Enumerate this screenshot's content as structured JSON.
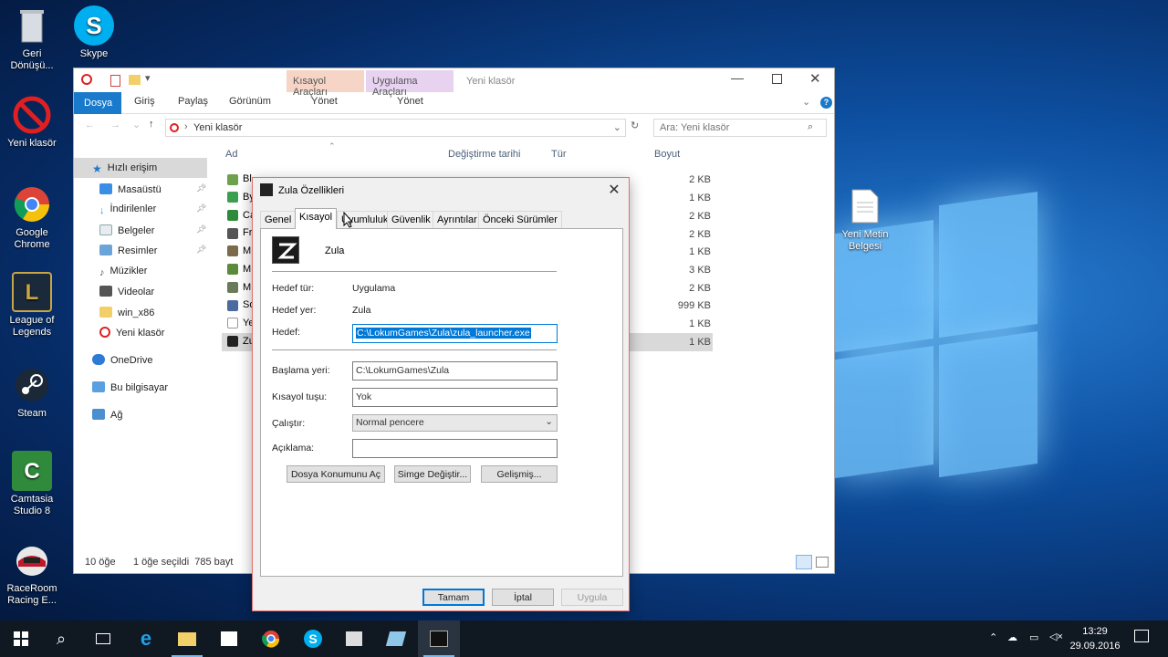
{
  "desktop": {
    "icons": [
      {
        "label": "Geri Dönüşü...",
        "icon": "recycle-bin-icon"
      },
      {
        "label": "Skype",
        "icon": "skype-icon"
      },
      {
        "label": "Yeni klasör",
        "icon": "no-entry-icon"
      },
      {
        "label": "Google Chrome",
        "icon": "chrome-icon"
      },
      {
        "label": "League of Legends",
        "icon": "league-icon"
      },
      {
        "label": "Steam",
        "icon": "steam-icon"
      },
      {
        "label": "Camtasia Studio 8",
        "icon": "camtasia-icon"
      },
      {
        "label": "RaceRoom Racing E...",
        "icon": "raceroom-icon"
      },
      {
        "label": "Yeni Metin Belgesi",
        "icon": "text-document-icon"
      }
    ]
  },
  "explorer": {
    "title": "Yeni klasör",
    "context_tabs": [
      {
        "group": "Kısayol Araçları",
        "tab": "Yönet",
        "color": "#f6d5c6"
      },
      {
        "group": "Uygulama Araçları",
        "tab": "Yönet",
        "color": "#e7d2f0"
      }
    ],
    "ribbon_tabs": [
      "Dosya",
      "Giriş",
      "Paylaş",
      "Görünüm"
    ],
    "address": "Yeni klasör",
    "search_placeholder": "Ara: Yeni klasör",
    "nav": {
      "quick_access": "Hızlı erişim",
      "items": [
        "Masaüstü",
        "İndirilenler",
        "Belgeler",
        "Resimler",
        "Müzikler",
        "Videolar",
        "win_x86",
        "Yeni klasör"
      ],
      "onedrive": "OneDrive",
      "this_pc": "Bu bilgisayar",
      "network": "Ağ"
    },
    "columns": {
      "name": "Ad",
      "modified": "Değiştirme tarihi",
      "type": "Tür",
      "size": "Boyut"
    },
    "files": [
      {
        "name": "Bl",
        "size": "2 KB"
      },
      {
        "name": "By",
        "size": "1 KB"
      },
      {
        "name": "Ca",
        "size": "2 KB"
      },
      {
        "name": "Fr",
        "size": "2 KB"
      },
      {
        "name": "M",
        "size": "1 KB"
      },
      {
        "name": "M",
        "size": "3 KB"
      },
      {
        "name": "M",
        "size": "2 KB"
      },
      {
        "name": "So",
        "size": "999 KB"
      },
      {
        "name": "Ye",
        "size": "1 KB"
      },
      {
        "name": "Zu",
        "size": "1 KB"
      }
    ],
    "status": {
      "count": "10 öğe",
      "selected": "1 öğe seçildi  785 bayt"
    }
  },
  "dialog": {
    "title": "Zula Özellikleri",
    "tabs": [
      "Genel",
      "Kısayol",
      "Uyumluluk",
      "Güvenlik",
      "Ayrıntılar",
      "Önceki Sürümler"
    ],
    "active_tab": "Kısayol",
    "name": "Zula",
    "target_type_label": "Hedef tür:",
    "target_type": "Uygulama",
    "target_location_label": "Hedef yer:",
    "target_location": "Zula",
    "target_label": "Hedef:",
    "target": "C:\\LokumGames\\Zula\\zula_launcher.exe",
    "start_in_label": "Başlama yeri:",
    "start_in": "C:\\LokumGames\\Zula",
    "shortcut_key_label": "Kısayol tuşu:",
    "shortcut_key": "Yok",
    "run_label": "Çalıştır:",
    "run": "Normal pencere",
    "comment_label": "Açıklama:",
    "comment": "",
    "btn_open_location": "Dosya Konumunu Aç",
    "btn_change_icon": "Simge Değiştir...",
    "btn_advanced": "Gelişmiş...",
    "btn_ok": "Tamam",
    "btn_cancel": "İptal",
    "btn_apply": "Uygula"
  },
  "taskbar": {
    "time": "13:29",
    "date": "29.09.2016"
  }
}
